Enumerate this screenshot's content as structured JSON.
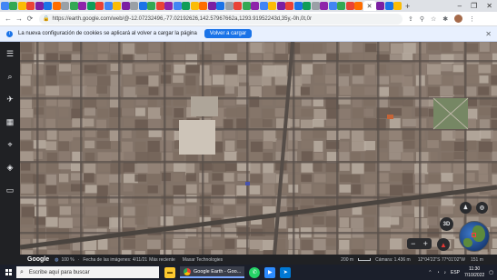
{
  "browser": {
    "address": "https://earth.google.com/web/@-12.07232496,-77.02192626,142.57967662a,1293.91952243d,35y,-0h,0t,0r",
    "tab_colors": [
      "#4285f4",
      "#34a853",
      "#fbbc05",
      "#ea4335",
      "#7b1fa2",
      "#1a73e8",
      "#ff6d00",
      "#9aa0a6",
      "#34a853",
      "#8e24aa",
      "#0f9d58",
      "#ea4335",
      "#4285f4",
      "#fbbc05",
      "#7b1fa2",
      "#9aa0a6",
      "#1a73e8",
      "#34a853",
      "#ea4335",
      "#8e24aa",
      "#4285f4",
      "#0f9d58",
      "#fbbc05",
      "#ff6d00",
      "#7b1fa2",
      "#1a73e8",
      "#9aa0a6",
      "#ea4335",
      "#34a853",
      "#8e24aa",
      "#4285f4",
      "#fbbc05",
      "#7b1fa2",
      "#ea4335",
      "#1a73e8",
      "#0f9d58",
      "#9aa0a6",
      "#8e24aa",
      "#4285f4",
      "#34a853",
      "#ea4335",
      "#ff6d00",
      "#7b1fa2",
      "#1a73e8",
      "#fbbc05"
    ],
    "icons": {
      "back": "←",
      "forward": "→",
      "reload": "⟳",
      "share": "⇪",
      "star": "☆",
      "extensions": "✱",
      "menu": "⋮",
      "minimize": "‒",
      "maximize": "❐",
      "close": "✕",
      "new_tab": "+",
      "tab_close": "✕"
    }
  },
  "infobar": {
    "message": "La nueva configuración de cookies se aplicará al volver a cargar la página",
    "button_label": "Volver a cargar"
  },
  "sidebar": {
    "icons": [
      "☰",
      "⌕",
      "✈",
      "▦",
      "⌖",
      "◈",
      "▭"
    ]
  },
  "map": {
    "controls": {
      "compass": "◎",
      "pegman": "♟",
      "view_3d": "3D",
      "zoom_minus": "−",
      "zoom_plus": "+",
      "location": "⦿"
    }
  },
  "statusbar": {
    "logo": "Google",
    "zoom": "100 %",
    "capture": "Fecha de las imágenes: 4/11/21",
    "recent": "Más reciente",
    "provider": "Maxar Technologies",
    "scale": "200 m",
    "camera": "Cámara: 1.436 m",
    "coords": "12°04'22\"S 77°01'02\"W",
    "elevation": "151 m"
  },
  "taskbar": {
    "search_placeholder": "Escribe aquí para buscar",
    "app_label": "Google Earth - Goo...",
    "lang": "ESP",
    "time": "11:30",
    "date": "7/10/2022"
  },
  "colors": {
    "accent": "#1a73e8",
    "sidebar_bg": "#202124",
    "taskbar_bg": "#1b1f2b",
    "map_base": "#8a7a6e"
  }
}
